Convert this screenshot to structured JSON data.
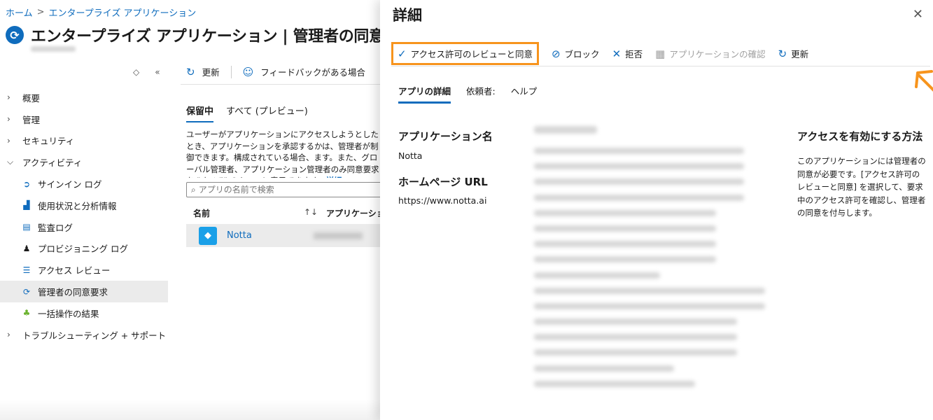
{
  "breadcrumb": {
    "home": "ホーム",
    "current": "エンタープライズ アプリケーション"
  },
  "page_title": "エンタープライズ アプリケーション | 管理者の同意要",
  "left_nav": {
    "items": [
      {
        "label": "概要",
        "type": "group",
        "expanded": false
      },
      {
        "label": "管理",
        "type": "group",
        "expanded": false
      },
      {
        "label": "セキュリティ",
        "type": "group",
        "expanded": false
      },
      {
        "label": "アクティビティ",
        "type": "group",
        "expanded": true
      },
      {
        "label": "サインイン ログ",
        "type": "sub",
        "icon": "sign-in-icon"
      },
      {
        "label": "使用状況と分析情報",
        "type": "sub",
        "icon": "analytics-icon"
      },
      {
        "label": "監査ログ",
        "type": "sub",
        "icon": "audit-log-icon"
      },
      {
        "label": "プロビジョニング ログ",
        "type": "sub",
        "icon": "provisioning-icon"
      },
      {
        "label": "アクセス レビュー",
        "type": "sub",
        "icon": "access-review-icon"
      },
      {
        "label": "管理者の同意要求",
        "type": "sub",
        "icon": "consent-icon",
        "active": true
      },
      {
        "label": "一括操作の結果",
        "type": "sub",
        "icon": "bulk-ops-icon"
      },
      {
        "label": "トラブルシューティング + サポート",
        "type": "group",
        "expanded": false
      }
    ]
  },
  "main": {
    "toolbar": {
      "refresh": "更新",
      "feedback": "フィードバックがある場合"
    },
    "tabs": {
      "pending": "保留中",
      "all": "すべて (プレビュー)"
    },
    "description": "ユーザーがアプリケーションにアクセスしようとしたとき、アプリケーションを承認するかは、管理者が制御できます。構成されている場合、ます。また、グローバル管理者、アプリケーション管理者のみ同意要求を \"すべて\" のキューに表示できます。",
    "description_link": "詳細",
    "search_placeholder": "アプリの名前で検索",
    "columns": {
      "name": "名前",
      "sort": "↑↓",
      "app": "アプリケーション"
    },
    "rows": [
      {
        "name": "Notta"
      }
    ]
  },
  "panel": {
    "title": "詳細",
    "toolbar": {
      "review": "アクセス許可のレビューと同意",
      "block": "ブロック",
      "deny": "拒否",
      "confirm_app": "アプリケーションの確認",
      "refresh": "更新"
    },
    "tabs": {
      "app_details": "アプリの詳細",
      "requested_by": "依頼者:",
      "help": "ヘルプ"
    },
    "fields": {
      "app_name_label": "アプリケーション名",
      "app_name_value": "Notta",
      "homepage_label": "ホームページ URL",
      "homepage_value": "https://www.notta.ai"
    },
    "help": {
      "title": "アクセスを有効にする方法",
      "text": "このアプリケーションには管理者の同意が必要です。[アクセス許可のレビューと同意] を選択して、要求中のアクセス許可を確認し、管理者の同意を付与します。"
    }
  },
  "colors": {
    "accent": "#0f6cbd",
    "highlight": "#f7941d",
    "active_bg": "#ebebeb"
  }
}
